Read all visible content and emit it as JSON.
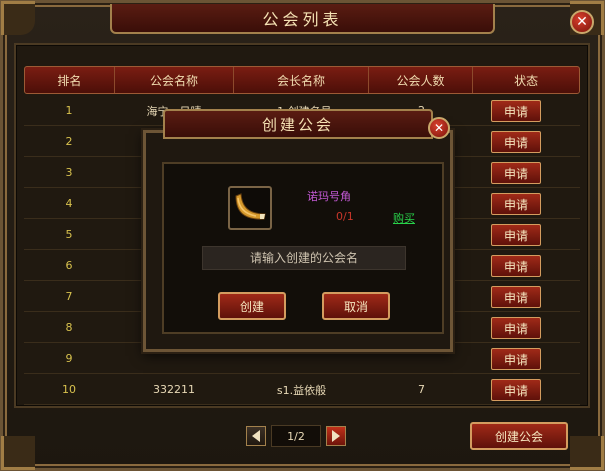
{
  "window": {
    "title": "公会列表"
  },
  "table": {
    "headers": [
      "排名",
      "公会名称",
      "会长名称",
      "公会人数",
      "状态"
    ],
    "rows": [
      {
        "rank": "1",
        "name": "海宁一日晴",
        "leader": "s1.创建名号",
        "count": "2",
        "status": "申请"
      },
      {
        "rank": "2",
        "name": "",
        "leader": "",
        "count": "",
        "status": "申请"
      },
      {
        "rank": "3",
        "name": "",
        "leader": "",
        "count": "",
        "status": "申请"
      },
      {
        "rank": "4",
        "name": "",
        "leader": "",
        "count": "",
        "status": "申请"
      },
      {
        "rank": "5",
        "name": "",
        "leader": "",
        "count": "",
        "status": "申请"
      },
      {
        "rank": "6",
        "name": "",
        "leader": "",
        "count": "",
        "status": "申请"
      },
      {
        "rank": "7",
        "name": "",
        "leader": "",
        "count": "",
        "status": "申请"
      },
      {
        "rank": "8",
        "name": "",
        "leader": "",
        "count": "",
        "status": "申请"
      },
      {
        "rank": "9",
        "name": "",
        "leader": "",
        "count": "",
        "status": "申请"
      },
      {
        "rank": "10",
        "name": "332211",
        "leader": "s1.益依般",
        "count": "7",
        "status": "申请"
      }
    ]
  },
  "pagination": {
    "page": "1/2"
  },
  "footer": {
    "create_guild_label": "创建公会"
  },
  "dialog": {
    "title": "创建公会",
    "item_name": "诺玛号角",
    "item_count": "0/1",
    "buy_label": "购买",
    "input_placeholder": "请输入创建的公会名",
    "create_label": "创建",
    "cancel_label": "取消"
  },
  "colors": {
    "accent_red": "#7a1d12",
    "gold_border": "#a3814c",
    "item_name": "#c45ad6",
    "item_count": "#c8362a",
    "buy_link": "#28d24a"
  },
  "icons": {
    "close": "close-icon",
    "prev": "arrow-left-icon",
    "next": "arrow-right-icon",
    "item": "horn-icon"
  }
}
